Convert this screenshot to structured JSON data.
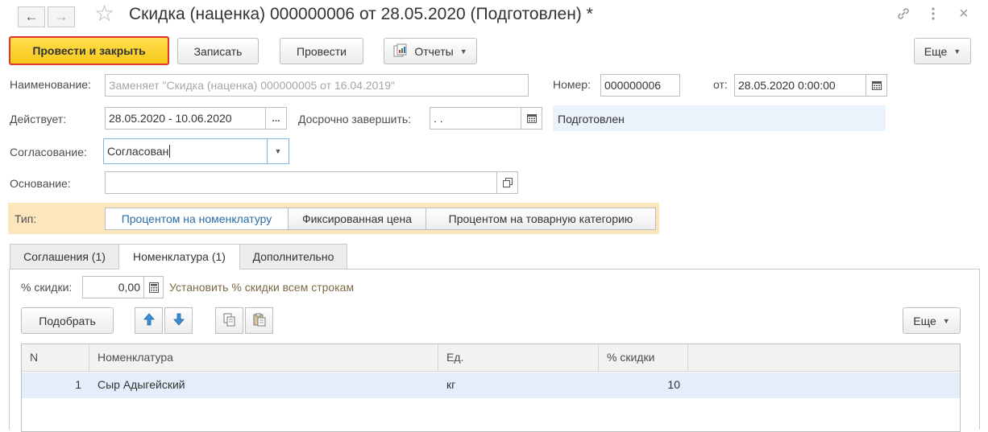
{
  "window": {
    "title": "Скидка (наценка) 000000006 от 28.05.2020 (Подготовлен) *",
    "back_icon": "←",
    "forward_icon": "→",
    "star_icon": "☆",
    "link_icon": "🔗",
    "more_icon": "⋮",
    "close_icon": "×"
  },
  "toolbar": {
    "post_close_label": "Провести и закрыть",
    "save_label": "Записать",
    "post_label": "Провести",
    "reports_label": "Отчеты",
    "more_label": "Еще"
  },
  "form": {
    "name_label": "Наименование:",
    "name_placeholder": "Заменяет \"Скидка (наценка) 000000005 от 16.04.2019\"",
    "number_label": "Номер:",
    "number_value": "000000006",
    "date_label": "от:",
    "date_value": "28.05.2020  0:00:00",
    "valid_label": "Действует:",
    "valid_value": "28.05.2020 - 10.06.2020",
    "valid_btn": "...",
    "early_label": "Досрочно завершить:",
    "early_value": " .  .",
    "status_value": "Подготовлен",
    "approval_label": "Согласование:",
    "approval_value": "Согласован",
    "basis_label": "Основание:",
    "basis_value": "",
    "type_label": "Тип:",
    "type_options": [
      "Процентом на номенклатуру",
      "Фиксированная цена",
      "Процентом на товарную категорию"
    ]
  },
  "tabs": [
    {
      "label": "Соглашения (1)"
    },
    {
      "label": "Номенклатура (1)"
    },
    {
      "label": "Дополнительно"
    }
  ],
  "nomenclature": {
    "discount_label": "% скидки:",
    "discount_value": "0,00",
    "set_all_link": "Установить % скидки всем строкам",
    "pick_label": "Подобрать",
    "more_label": "Еще"
  },
  "table": {
    "columns": [
      "N",
      "Номенклатура",
      "Ед.",
      "% скидки"
    ],
    "rows": [
      {
        "n": "1",
        "item": "Сыр Адыгейский",
        "unit": "кг",
        "discount": "10"
      }
    ]
  },
  "colors": {
    "primary_button": "#f6c81a",
    "primary_border": "#e1352b",
    "type_row_bg": "#fbe6be",
    "selected_row": "#e3eefa",
    "link": "#7b6b44"
  }
}
